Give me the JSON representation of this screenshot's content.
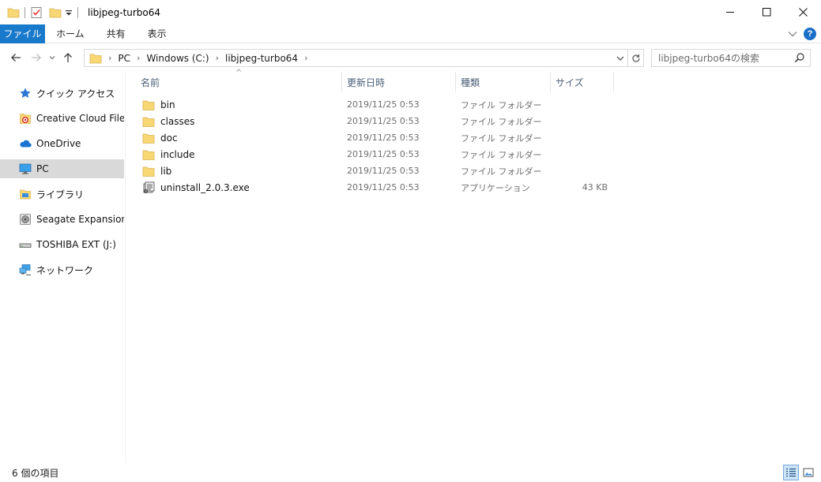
{
  "window": {
    "title": "libjpeg-turbo64"
  },
  "ribbon": {
    "file_tab": "ファイル",
    "tabs": [
      "ホーム",
      "共有",
      "表示"
    ]
  },
  "address": {
    "crumbs": [
      "PC",
      "Windows (C:)",
      "libjpeg-turbo64"
    ]
  },
  "search": {
    "placeholder": "libjpeg-turbo64の検索"
  },
  "sidebar": {
    "items": [
      {
        "label": "クイック アクセス",
        "icon": "star-icon"
      },
      {
        "label": "Creative Cloud Files",
        "icon": "creative-cloud-icon"
      },
      {
        "label": "OneDrive",
        "icon": "cloud-icon"
      },
      {
        "label": "PC",
        "icon": "computer-icon",
        "selected": true
      },
      {
        "label": "ライブラリ",
        "icon": "library-icon"
      },
      {
        "label": "Seagate Expansion Dr",
        "icon": "drive-icon"
      },
      {
        "label": "TOSHIBA EXT (J:)",
        "icon": "usb-drive-icon"
      },
      {
        "label": "ネットワーク",
        "icon": "network-icon"
      }
    ]
  },
  "columns": {
    "name": "名前",
    "date": "更新日時",
    "type": "種類",
    "size": "サイズ"
  },
  "files": [
    {
      "name": "bin",
      "date": "2019/11/25 0:53",
      "type": "ファイル フォルダー",
      "size": "",
      "icon": "folder-icon"
    },
    {
      "name": "classes",
      "date": "2019/11/25 0:53",
      "type": "ファイル フォルダー",
      "size": "",
      "icon": "folder-icon"
    },
    {
      "name": "doc",
      "date": "2019/11/25 0:53",
      "type": "ファイル フォルダー",
      "size": "",
      "icon": "folder-icon"
    },
    {
      "name": "include",
      "date": "2019/11/25 0:53",
      "type": "ファイル フォルダー",
      "size": "",
      "icon": "folder-icon"
    },
    {
      "name": "lib",
      "date": "2019/11/25 0:53",
      "type": "ファイル フォルダー",
      "size": "",
      "icon": "folder-icon"
    },
    {
      "name": "uninstall_2.0.3.exe",
      "date": "2019/11/25 0:53",
      "type": "アプリケーション",
      "size": "43 KB",
      "icon": "installer-icon"
    }
  ],
  "status": {
    "item_count": "6 個の項目"
  },
  "colors": {
    "file_tab": "#1979ca",
    "folder": "#f8d775",
    "selected_nav": "#d9d9d9"
  }
}
